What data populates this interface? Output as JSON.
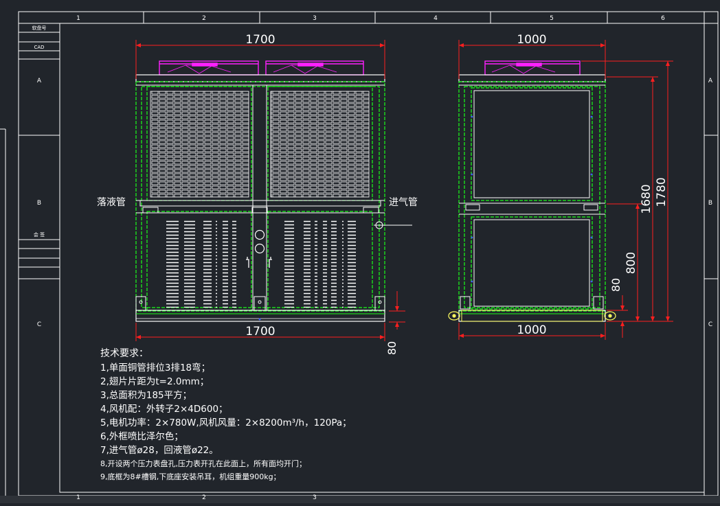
{
  "colors": {
    "background": "#21252b",
    "frame": "#ffffff",
    "dimension": "#ff1f1f",
    "fan": "#ff20ff",
    "coil": "#1aff1a",
    "structure": "#ffffff",
    "accent_blue": "#4060ff",
    "yellow": "#ffff60"
  },
  "border": {
    "column_labels": [
      "1",
      "2",
      "3",
      "4",
      "5",
      "6"
    ],
    "row_labels": [
      "A",
      "B",
      "C"
    ],
    "title_block": {
      "top": "软盘号",
      "cad": "CAD",
      "sign": "会 签"
    }
  },
  "front_view": {
    "width_top": "1700",
    "width_bottom": "1700",
    "base_height": "80",
    "label_left": "落液管",
    "label_right": "进气管"
  },
  "side_view": {
    "width_top": "1000",
    "width_bottom": "1000",
    "height_total": "1780",
    "height_body": "1680",
    "height_lower": "800",
    "height_base": "80"
  },
  "notes": {
    "title": "技术要求：",
    "items": [
      "1,单面铜管排位3排18弯；",
      "2,翅片片距为t=2.0mm；",
      "3,总面积为185平方；",
      "4,风机配：外转子2×4D600；",
      "5,电机功率：2×780W,风机风量：2×8200m³/h，120Pa；",
      "6,外框喷比泽尔色；",
      "7,进气管ø28，回液管ø22。",
      "8,开设两个压力表盘孔,压力表开孔在此面上，所有面均开门；",
      "9,底框为8#槽钢,下底座安装吊耳，机组重量900kg；"
    ]
  }
}
